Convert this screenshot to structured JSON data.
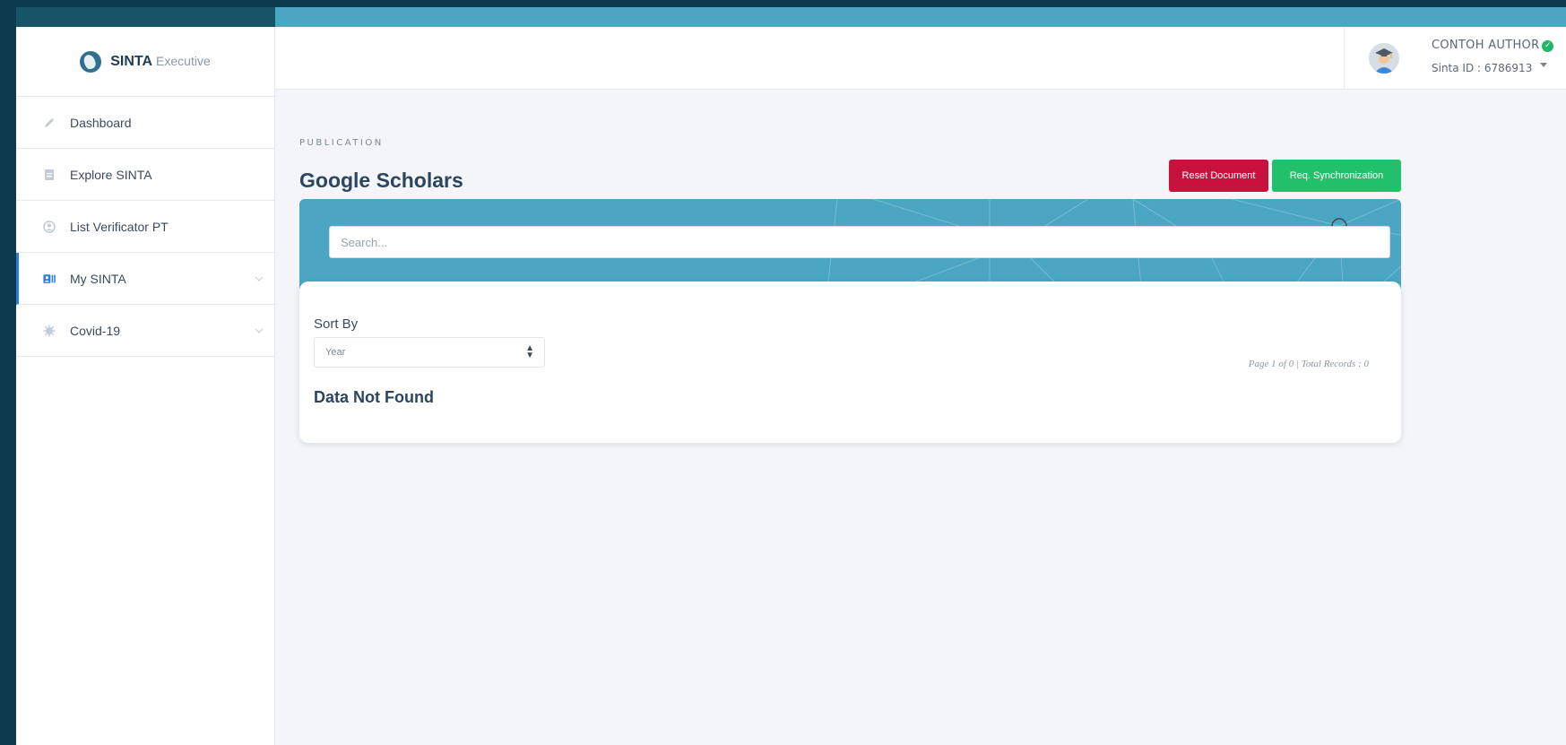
{
  "brand": {
    "name": "SINTA",
    "subtitle": "Executive"
  },
  "sidebar": {
    "items": [
      {
        "label": "Dashboard",
        "icon": "pencil-icon"
      },
      {
        "label": "Explore SINTA",
        "icon": "document-icon"
      },
      {
        "label": "List Verificator PT",
        "icon": "user-circle-icon"
      },
      {
        "label": "My SINTA",
        "icon": "id-card-icon",
        "active": true,
        "expandable": true
      },
      {
        "label": "Covid-19",
        "icon": "virus-icon",
        "expandable": true
      }
    ]
  },
  "user": {
    "name": "CONTOH AUTHOR",
    "sinta_id": "Sinta ID : 6786913",
    "verified": true
  },
  "page": {
    "section": "PUBLICATION",
    "title": "Google Scholars"
  },
  "actions": {
    "reset_label": "Reset Document",
    "sync_label": "Req. Synchronization"
  },
  "search": {
    "placeholder": "Search..."
  },
  "sort": {
    "label": "Sort By",
    "value": "Year"
  },
  "results": {
    "page_info": "Page 1 of 0 | Total Records : 0",
    "empty_message": "Data Not Found"
  },
  "colors": {
    "accent_teal": "#4aa6c3",
    "reset_red": "#c8123e",
    "sync_green": "#21c06a",
    "active_blue": "#2d7fd9"
  }
}
